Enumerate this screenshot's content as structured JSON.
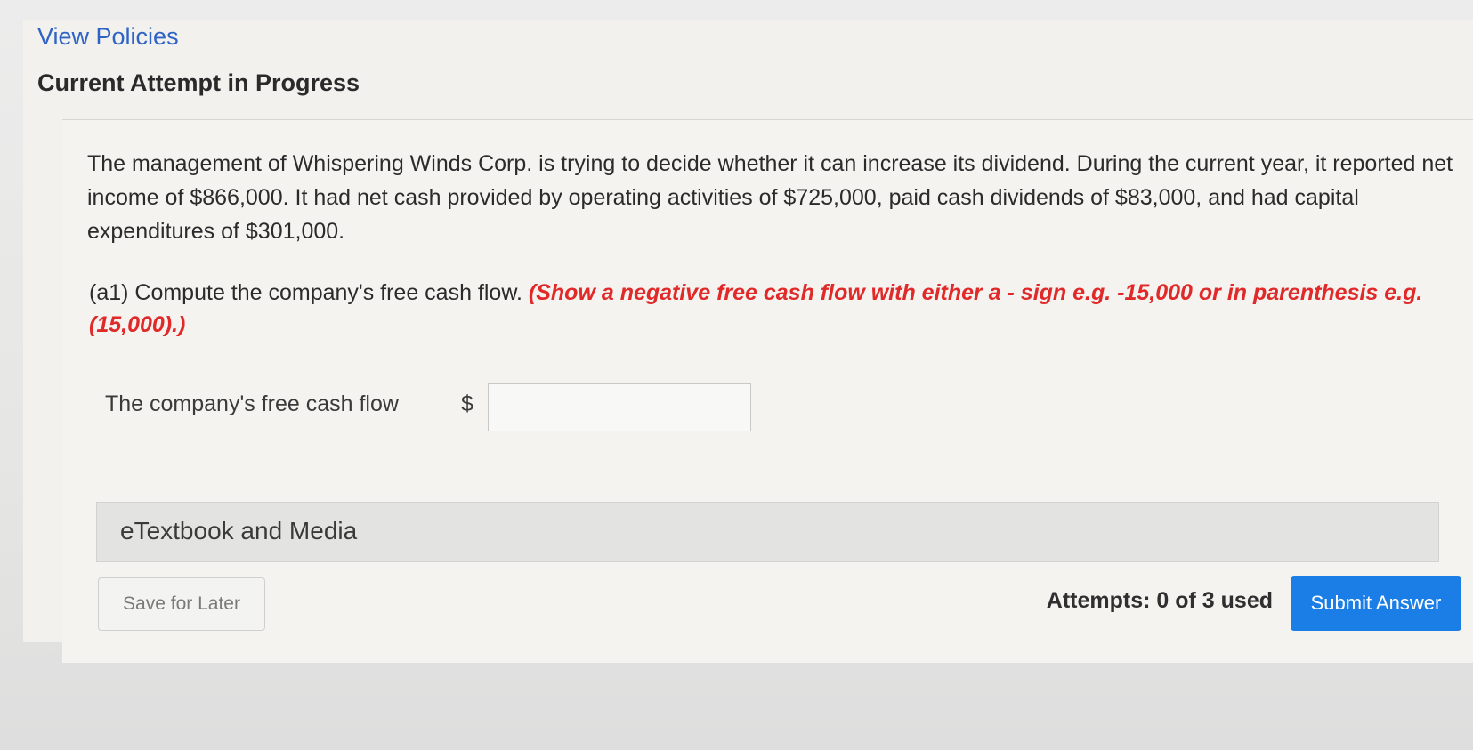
{
  "header": {
    "view_policies_link": "View Policies",
    "attempt_title": "Current Attempt in Progress"
  },
  "question": {
    "problem_text": "The management of Whispering Winds Corp. is trying to decide whether it can increase its dividend. During the current year, it reported net income of $866,000. It had net cash provided by operating activities of $725,000, paid cash dividends of $83,000, and had capital expenditures of $301,000.",
    "instruction_prefix": "(a1) Compute the company's free cash flow.",
    "instruction_note": "(Show a negative free cash flow with either a - sign e.g. -15,000 or in parenthesis e.g. (15,000).)"
  },
  "answer": {
    "label": "The company's free cash flow",
    "currency_symbol": "$",
    "value": ""
  },
  "resources": {
    "etextbook_label": "eTextbook and Media"
  },
  "footer": {
    "save_label": "Save for Later",
    "attempts_text": "Attempts: 0 of 3 used",
    "submit_label": "Submit Answer"
  },
  "colors": {
    "link": "#2f63c4",
    "instruction_note": "#e02a2a",
    "submit_bg": "#1a7ee6"
  }
}
